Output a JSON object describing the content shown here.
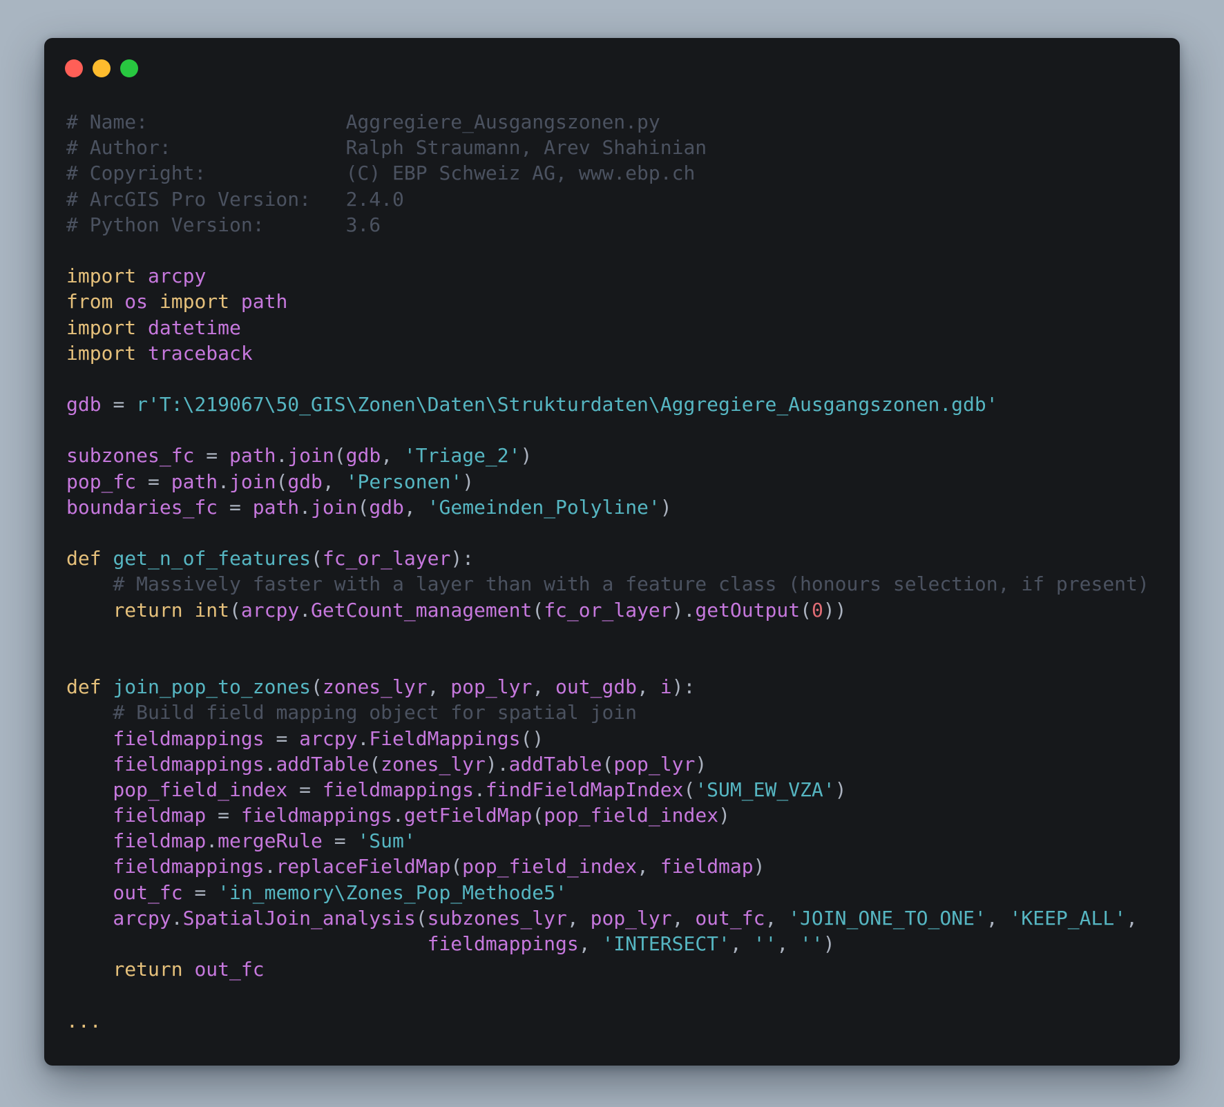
{
  "window": {
    "controls": [
      "close",
      "minimize",
      "maximize"
    ],
    "background_color": "#16181b",
    "page_background_color": "#a9b5c1"
  },
  "code": {
    "language": "python",
    "colors": {
      "keyword": "#e5c07b",
      "identifier": "#c678dd",
      "string": "#56b6c2",
      "comment": "#4b5260",
      "punctuation": "#abb2bf",
      "number": "#e06c75"
    },
    "header": [
      {
        "label": "# Name:",
        "value": "Aggregiere_Ausgangszonen.py"
      },
      {
        "label": "# Author:",
        "value": "Ralph Straumann, Arev Shahinian"
      },
      {
        "label": "# Copyright:",
        "value": "(C) EBP Schweiz AG, www.ebp.ch"
      },
      {
        "label": "# ArcGIS Pro Version:",
        "value": "2.4.0"
      },
      {
        "label": "# Python Version:",
        "value": "3.6"
      }
    ],
    "imports": [
      "import arcpy",
      "from os import path",
      "import datetime",
      "import traceback"
    ],
    "gdb_line": "gdb = r'T:\\219067\\50_GIS\\Zonen\\Daten\\Strukturdaten\\Aggregiere_Ausgangszonen.gdb'",
    "fc_lines": [
      "subzones_fc = path.join(gdb, 'Triage_2')",
      "pop_fc = path.join(gdb, 'Personen')",
      "boundaries_fc = path.join(gdb, 'Gemeinden_Polyline')"
    ],
    "func1": [
      "def get_n_of_features(fc_or_layer):",
      "    # Massively faster with a layer than with a feature class (honours selection, if present)",
      "    return int(arcpy.GetCount_management(fc_or_layer).getOutput(0))"
    ],
    "func2": [
      "def join_pop_to_zones(zones_lyr, pop_lyr, out_gdb, i):",
      "    # Build field mapping object for spatial join",
      "    fieldmappings = arcpy.FieldMappings()",
      "    fieldmappings.addTable(zones_lyr).addTable(pop_lyr)",
      "    pop_field_index = fieldmappings.findFieldMapIndex('SUM_EW_VZA')",
      "    fieldmap = fieldmappings.getFieldMap(pop_field_index)",
      "    fieldmap.mergeRule = 'Sum'",
      "    fieldmappings.replaceFieldMap(pop_field_index, fieldmap)",
      "    out_fc = 'in_memory\\Zones_Pop_Methode5'",
      "    arcpy.SpatialJoin_analysis(subzones_lyr, pop_lyr, out_fc, 'JOIN_ONE_TO_ONE', 'KEEP_ALL',",
      "                               fieldmappings, 'INTERSECT', '', '')",
      "    return out_fc"
    ],
    "ellipsis": "..."
  }
}
